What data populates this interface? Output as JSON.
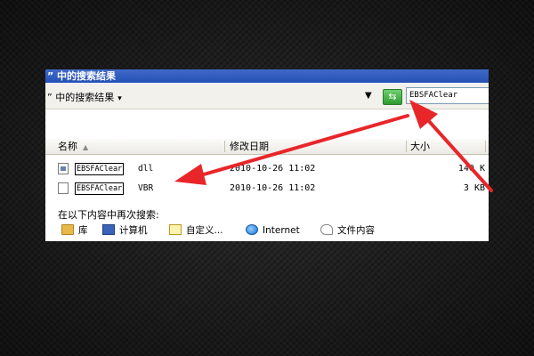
{
  "window": {
    "title": "” 中的搜索结果"
  },
  "address_bar": {
    "location": "” 中的搜索结果",
    "dropdown_caret": "▾",
    "dropdown_arrow": "▼",
    "go_icon": "go-arrow-icon",
    "search_value": "EBSFAClear"
  },
  "columns": {
    "name": "名称",
    "name_sort": "▲",
    "date": "修改日期",
    "size": "大小"
  },
  "files": [
    {
      "name": "EBSFAClear",
      "ext": "dll",
      "modified": "2010-10-26 11:02",
      "size": "140 K",
      "icon": "dll-file-icon"
    },
    {
      "name": "EBSFAClear",
      "ext": "VBR",
      "modified": "2010-10-26 11:02",
      "size": "3 KB",
      "icon": "generic-file-icon"
    }
  ],
  "search_again": {
    "label": "在以下内容中再次搜索:",
    "locations": [
      {
        "label": "库",
        "icon": "library-icon"
      },
      {
        "label": "计算机",
        "icon": "computer-icon"
      },
      {
        "label": "自定义...",
        "icon": "custom-folder-icon"
      },
      {
        "label": "Internet",
        "icon": "internet-explorer-icon"
      },
      {
        "label": "文件内容",
        "icon": "file-content-icon"
      }
    ]
  },
  "annotation": {
    "arrow_color": "#e8262a"
  }
}
